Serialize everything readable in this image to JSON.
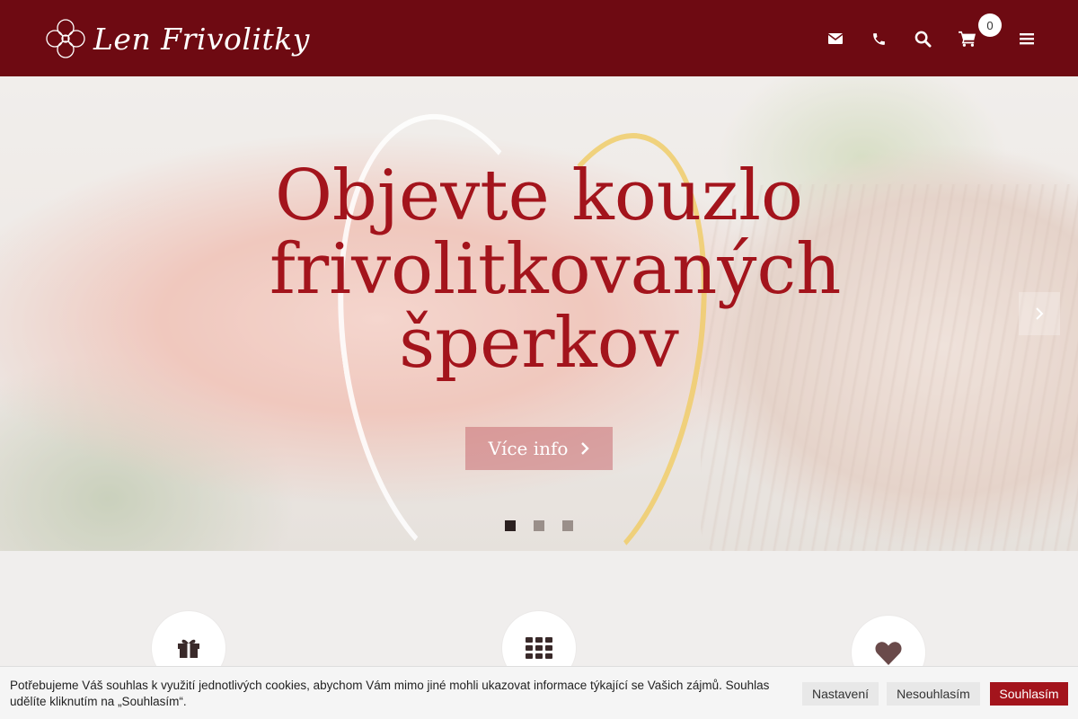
{
  "header": {
    "logo_text": "Len Frivolitky",
    "cart_count": "0",
    "icons": [
      "envelope-icon",
      "phone-icon",
      "search-icon",
      "cart-icon",
      "menu-icon"
    ]
  },
  "hero": {
    "title_lines": [
      "Objevte kouzlo",
      "frivolitkovaných",
      "šperkov"
    ],
    "button_label": "Více info",
    "slides": 3,
    "active_slide": 1
  },
  "features": {
    "icons": [
      "gift-icon",
      "grid-icon",
      "heart-icon"
    ]
  },
  "cookie": {
    "text": "Potřebujeme Váš souhlas k využití jednotlivých cookies, abychom Vám mimo jiné mohli ukazovat informace týkající se Vašich zájmů. Souhlas udělíte kliknutím na „Souhlasím“.",
    "settings_label": "Nastavení",
    "decline_label": "Nesouhlasím",
    "accept_label": "Souhlasím"
  },
  "colors": {
    "brand": "#6e0a12",
    "accent": "#a3141c",
    "background": "#f0eeed"
  }
}
